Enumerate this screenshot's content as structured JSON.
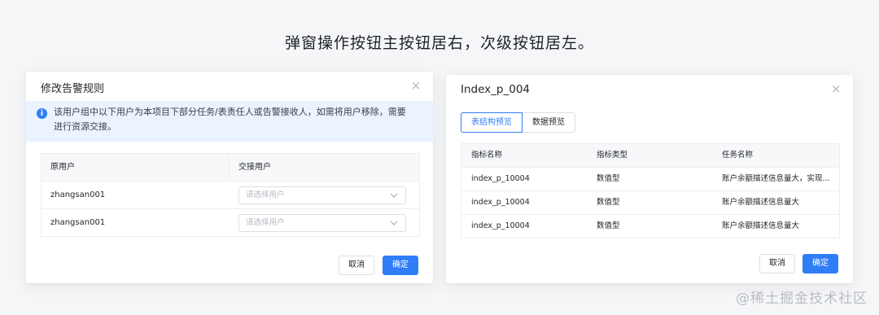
{
  "heading": "弹窗操作按钮主按钮居右，次级按钮居左。",
  "modal_left": {
    "title": "修改告警规则",
    "notice": "该用户组中以下用户为本项目下部分任务/表责任人或告警接收人，如需将用户移除，需要进行资源交接。",
    "columns": [
      "原用户",
      "交接用户"
    ],
    "rows": [
      {
        "user": "zhangsan001",
        "placeholder": "请选择用户"
      },
      {
        "user": "zhangsan001",
        "placeholder": "请选择用户"
      }
    ],
    "cancel_label": "取消",
    "ok_label": "确定"
  },
  "modal_right": {
    "title": "Index_p_004",
    "tabs": [
      "表结构预览",
      "数据预览"
    ],
    "columns": [
      "指标名称",
      "指标类型",
      "任务名称"
    ],
    "rows": [
      [
        "index_p_10004",
        "数值型",
        "账户余额描述信息量大，实现..."
      ],
      [
        "index_p_10004",
        "数值型",
        "账户余额描述信息量大"
      ],
      [
        "index_p_10004",
        "数值型",
        "账户余额描述信息量大"
      ]
    ],
    "cancel_label": "取消",
    "ok_label": "确定"
  },
  "watermark": "@稀土掘金技术社区",
  "colors": {
    "primary": "#2f7ef8",
    "notice_bg": "#eaf3ff",
    "page_bg": "#f5f6f8"
  }
}
